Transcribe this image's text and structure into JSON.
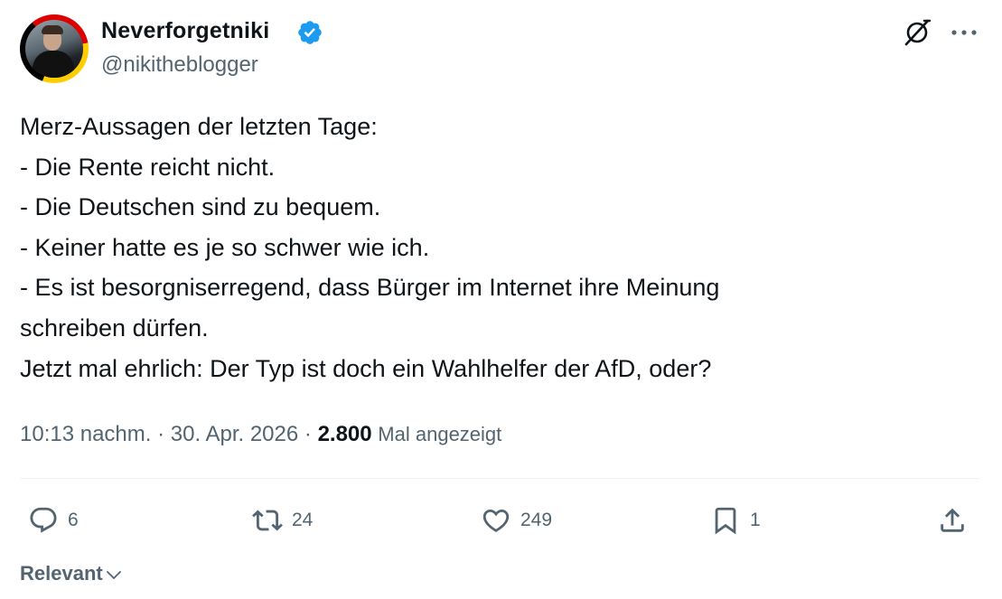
{
  "author": {
    "display_name": "Neverforgetniki",
    "handle": "@nikitheblogger",
    "verified": true
  },
  "icons": {
    "verified": "verified-badge-icon",
    "grok": "grok-icon",
    "more": "more-icon",
    "reply": "reply-icon",
    "retweet": "retweet-icon",
    "like": "heart-icon",
    "bookmark": "bookmark-icon",
    "share": "share-icon",
    "sort": "chevron-down-icon"
  },
  "colors": {
    "verified": "#1d9bf0",
    "text": "#0f1419",
    "muted": "#536471",
    "divider": "#eff3f4"
  },
  "tweet": {
    "lines": [
      "Merz-Aussagen der letzten Tage:",
      "- Die Rente reicht nicht.",
      "- Die Deutschen sind zu bequem.",
      "- Keiner hatte es je so schwer wie ich.",
      "- Es ist besorgniserregend, dass Bürger im Internet ihre Meinung",
      "schreiben dürfen.",
      "Jetzt mal ehrlich: Der Typ ist doch ein Wahlhelfer der AfD, oder?"
    ]
  },
  "meta": {
    "time": "10:13 nachm.",
    "separator": " · ",
    "date": "30. Apr. 2026",
    "views_count": "2.800",
    "views_label": "Mal angezeigt"
  },
  "actions": {
    "replies": "6",
    "retweets": "24",
    "likes": "249",
    "bookmarks": "1"
  },
  "sort": {
    "label": "Relevant"
  }
}
